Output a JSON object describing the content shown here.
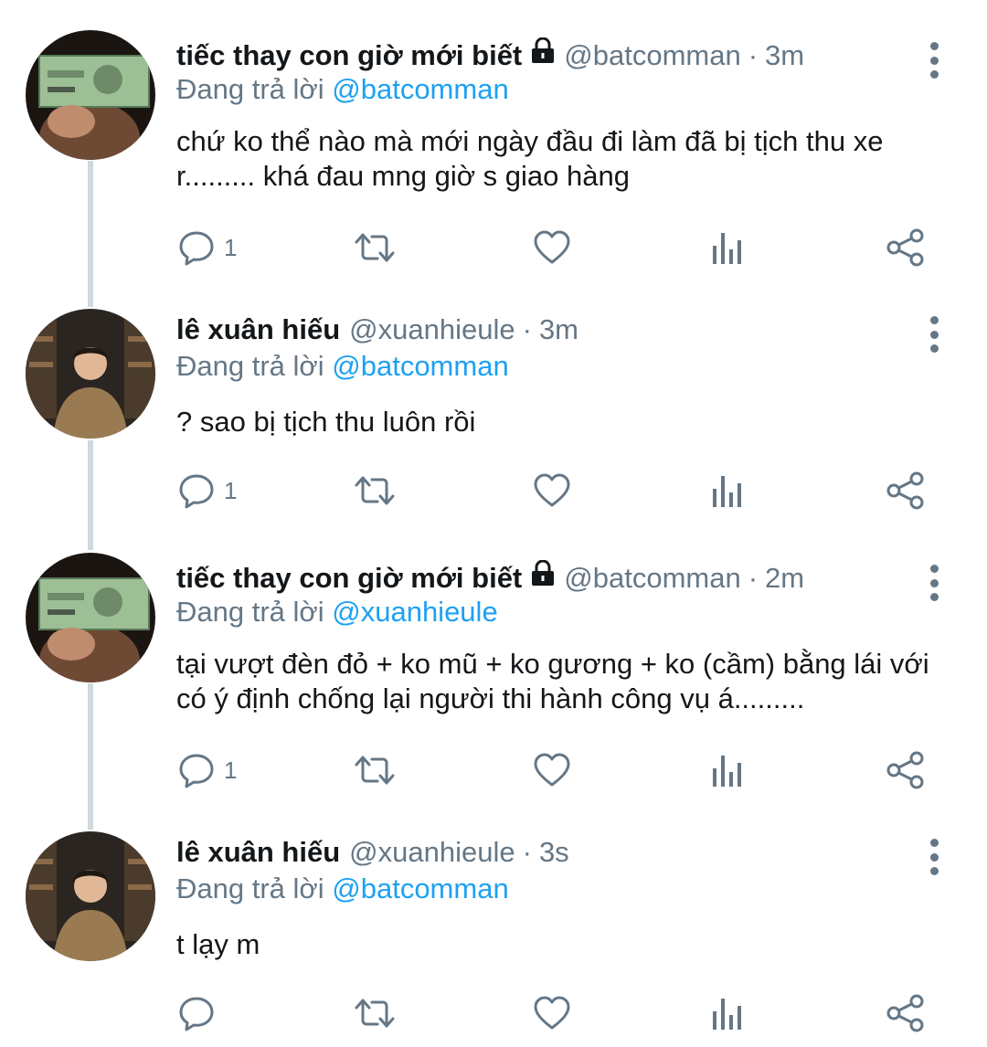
{
  "tweets": [
    {
      "name": "tiếc thay con giờ mới biết",
      "locked": true,
      "handle": "@batcomman",
      "time": "3m",
      "replying_prefix": "Đang trả lời",
      "replying_to": "@batcomman",
      "text": "chứ ko thể nào mà mới ngày đầu đi làm đã bị tịch thu xe r......... khá đau mng giờ s giao hàng",
      "reply_count": "1",
      "avatar": "banknote-avatar"
    },
    {
      "name": "lê xuân hiếu",
      "locked": false,
      "handle": "@xuanhieule",
      "time": "3m",
      "replying_prefix": "Đang trả lời",
      "replying_to": "@batcomman",
      "text": "? sao bị tịch thu luôn rồi",
      "reply_count": "1",
      "avatar": "person-avatar"
    },
    {
      "name": "tiếc thay con giờ mới biết",
      "locked": true,
      "handle": "@batcomman",
      "time": "2m",
      "replying_prefix": "Đang trả lời",
      "replying_to": "@xuanhieule",
      "text": "tại vượt đèn đỏ + ko mũ + ko gương + ko (cầm) bằng lái với có ý định chống lại người thi hành công vụ á.........",
      "reply_count": "1",
      "avatar": "banknote-avatar"
    },
    {
      "name": "lê xuân hiếu",
      "locked": false,
      "handle": "@xuanhieule",
      "time": "3s",
      "replying_prefix": "Đang trả lời",
      "replying_to": "@batcomman",
      "text": "t lạy m",
      "reply_count": "",
      "avatar": "person-avatar"
    }
  ],
  "separator": "·",
  "icons": [
    "reply-icon",
    "retweet-icon",
    "like-icon",
    "analytics-icon",
    "share-icon",
    "more-options-icon",
    "lock-icon"
  ],
  "colors": {
    "mention": "#1da1f2",
    "muted": "#657786",
    "thread_line": "#cfd9de"
  }
}
